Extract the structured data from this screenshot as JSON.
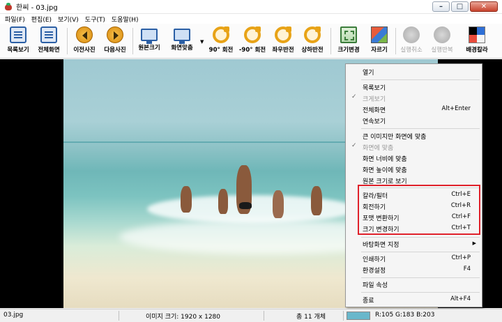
{
  "window": {
    "title": "한씨 - 03.jpg"
  },
  "menu": [
    "파일(F)",
    "편집(E)",
    "보기(V)",
    "도구(T)",
    "도움말(H)"
  ],
  "toolbar": {
    "list_view": "목록보기",
    "fullscreen": "전체화면",
    "prev": "이전사진",
    "next": "다음사진",
    "original_size": "원본크기",
    "fit_screen": "화면맞춤",
    "rotate_90": "90° 회전",
    "rotate_m90": "-90° 회전",
    "flip_h": "좌우반전",
    "flip_v": "상하반전",
    "resize": "크기변경",
    "crop": "자르기",
    "undo": "실행취소",
    "redo": "실행반복",
    "bg_color": "배경칼라"
  },
  "context_menu": {
    "open": "열기",
    "list_view": "목록보기",
    "large_view": "크게보기",
    "fullscreen": "전체화면",
    "fullscreen_shortcut": "Alt+Enter",
    "continuous_view": "연속보기",
    "fit_large_only": "큰 이미지만 화면에 맞춤",
    "fit_screen": "화면에 맞춤",
    "fit_width": "화면 너비에 맞춤",
    "fit_height": "화면 높이에 맞춤",
    "original_size": "원본 크기로 보기",
    "color_filter": "칼라/필터",
    "color_filter_shortcut": "Ctrl+E",
    "rotate": "회전하기",
    "rotate_shortcut": "Ctrl+R",
    "convert_format": "포맷 변환하기",
    "convert_format_shortcut": "Ctrl+F",
    "resize": "크기 변경하기",
    "resize_shortcut": "Ctrl+T",
    "set_wallpaper": "바탕화면 지정",
    "print": "인쇄하기",
    "print_shortcut": "Ctrl+P",
    "settings": "환경설정",
    "settings_shortcut": "F4",
    "file_properties": "파일 속성",
    "exit": "종료",
    "exit_shortcut": "Alt+F4"
  },
  "status": {
    "filename": "03.jpg",
    "image_size": "이미지 크기: 1920 x 1280",
    "total_count": "총 11 개체",
    "pixel_color": "R:105 G:183 B:203",
    "swatch_color": "#69b7cb"
  }
}
